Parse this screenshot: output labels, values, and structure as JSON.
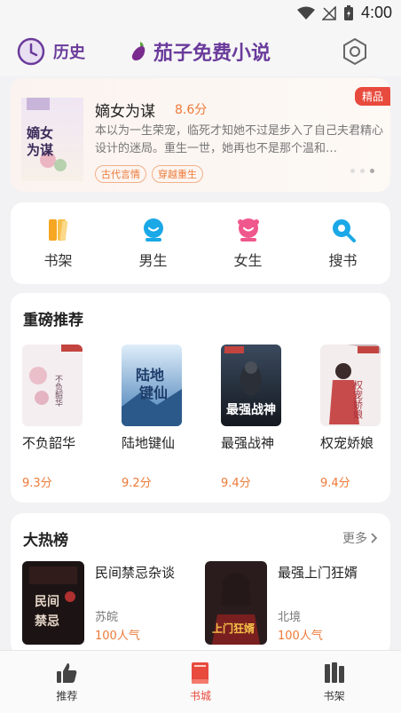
{
  "status_bar": {
    "time": "4:00"
  },
  "header": {
    "history_label": "历史",
    "app_title": "茄子免费小说"
  },
  "featured": {
    "badge": "精品",
    "title": "嫡女为谋",
    "score": "8.6分",
    "description": "本以为一生荣宠，临死才知她不过是步入了自己夫君精心设计的迷局。重生一世，她再也不是那个温和…",
    "tags": [
      "古代言情",
      "穿越重生"
    ],
    "cover_text": "嫡女为谋"
  },
  "categories": [
    {
      "label": "书架",
      "icon": "bookshelf-icon",
      "color": "#f5a623"
    },
    {
      "label": "男生",
      "icon": "male-icon",
      "color": "#1aa8e6"
    },
    {
      "label": "女生",
      "icon": "female-icon",
      "color": "#f0578c"
    },
    {
      "label": "搜书",
      "icon": "search-icon",
      "color": "#1aa8e6"
    }
  ],
  "recommend": {
    "title": "重磅推荐",
    "books": [
      {
        "name": "不负韶华",
        "score": "9.3分",
        "cover_text": "不负韶华"
      },
      {
        "name": "陆地键仙",
        "score": "9.2分",
        "cover_text": "陆地键仙"
      },
      {
        "name": "最强战神",
        "score": "9.4分",
        "cover_text": "最强战神"
      },
      {
        "name": "权宠娇娘",
        "score": "9.4分",
        "cover_text": "权宠娇娘"
      }
    ]
  },
  "hot": {
    "title": "大热榜",
    "more_label": "更多",
    "books": [
      {
        "name": "民间禁忌杂谈",
        "author": "苏皖",
        "popularity": "100人气",
        "cover_text": "民间禁忌"
      },
      {
        "name": "最强上门狂婿",
        "author": "北境",
        "popularity": "100人气",
        "cover_text": "上门狂婿"
      }
    ]
  },
  "bottom_nav": [
    {
      "label": "推荐",
      "icon": "thumbs-up-icon",
      "active": false
    },
    {
      "label": "书城",
      "icon": "book-icon",
      "active": true
    },
    {
      "label": "书架",
      "icon": "shelf-icon",
      "active": false
    }
  ],
  "colors": {
    "brand_purple": "#6a3b9b",
    "accent_orange": "#ee7a38",
    "active_red": "#e84a3d"
  }
}
